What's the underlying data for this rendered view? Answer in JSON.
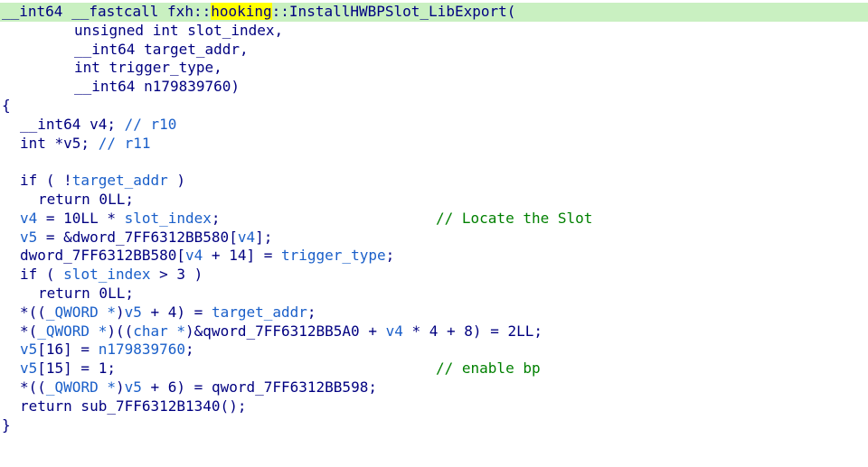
{
  "editor": {
    "signature": {
      "ret": "__int64",
      "callconv": "__fastcall",
      "ns1": "fxh",
      "sep": "::",
      "ns2": "hooking",
      "func": "InstallHWBPSlot_LibExport",
      "open": "(",
      "params": [
        "unsigned int slot_index,",
        "__int64 target_addr,",
        "int trigger_type,",
        "__int64 n179839760)"
      ]
    },
    "body": {
      "open_brace": "{",
      "close_brace": "}",
      "decl_v4": "__int64 v4;",
      "decl_v4_cmt": "// r10",
      "decl_v5": "int *v5;",
      "decl_v5_cmt": "// r11",
      "if1_pre": "if ( !",
      "if1_var": "target_addr",
      "if1_post": " )",
      "ret0": "return 0LL;",
      "l_v4a": "v4",
      "l_v4b": " = 10LL * ",
      "l_v4c": "slot_index",
      "l_v4d": ";",
      "l_v4_cmt": "// Locate the Slot",
      "l_v5a": "v5",
      "l_v5b": " = &dword_7FF6312BB580[",
      "l_v5c": "v4",
      "l_v5d": "];",
      "l_dwa": "dword_7FF6312BB580[",
      "l_dwb": "v4",
      "l_dwc": " + 14] = ",
      "l_dwd": "trigger_type",
      "l_dwe": ";",
      "if2_pre": "if ( ",
      "if2_var": "slot_index",
      "if2_post": " > 3 )",
      "q1a": "*((",
      "q1b": "_QWORD *",
      "q1c": ")",
      "q1d": "v5",
      "q1e": " + 4) = ",
      "q1f": "target_addr",
      "q1g": ";",
      "q2a": "*(",
      "q2b": "_QWORD *",
      "q2c": ")((",
      "q2d": "char *",
      "q2e": ")&qword_7FF6312BB5A0 + ",
      "q2f": "v4",
      "q2g": " * 4 + 8) = 2LL;",
      "a16a": "v5",
      "a16b": "[16] = ",
      "a16c": "n179839760",
      "a16d": ";",
      "a15a": "v5",
      "a15b": "[15] = 1;",
      "a15_cmt": "// enable bp",
      "q3a": "*((",
      "q3b": "_QWORD *",
      "q3c": ")",
      "q3d": "v5",
      "q3e": " + 6) = qword_7FF6312BB598;",
      "retsub": "return sub_7FF6312B1340();"
    }
  }
}
